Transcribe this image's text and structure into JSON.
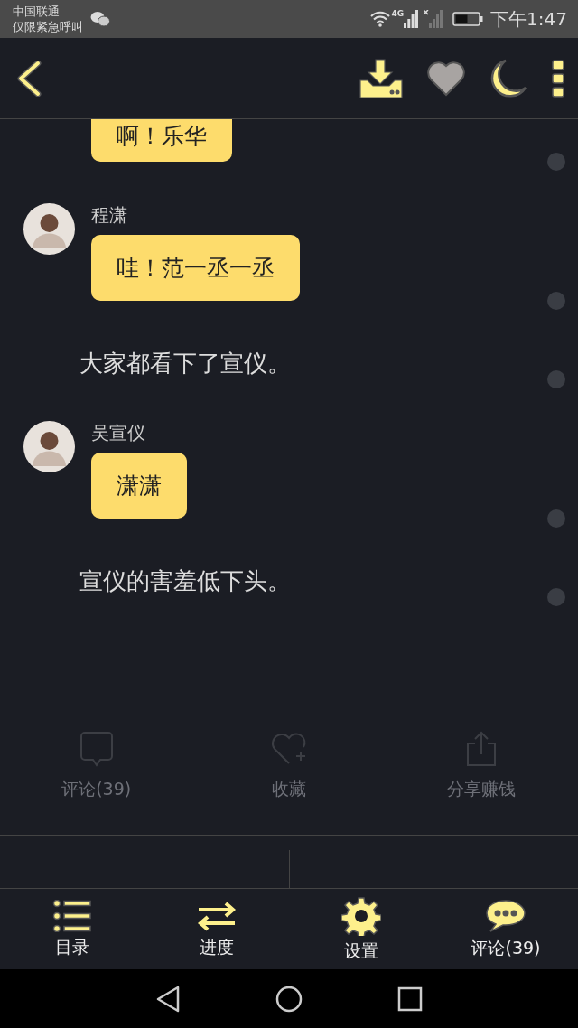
{
  "status_bar": {
    "carrier": "中国联通",
    "notice": "仅限紧急呼叫",
    "network": "4G",
    "time": "下午1:47"
  },
  "header": {
    "favorite": false
  },
  "messages": [
    {
      "kind": "bubble",
      "text": "啊！乐华"
    },
    {
      "kind": "chat",
      "name": "程潇",
      "text": "哇！范一丞一丞"
    },
    {
      "kind": "narration",
      "text": "大家都看下了宣仪。"
    },
    {
      "kind": "chat",
      "name": "吴宣仪",
      "text": "潇潇"
    },
    {
      "kind": "narration",
      "text": "宣仪的害羞低下头。"
    }
  ],
  "actions": [
    {
      "kind": "comment",
      "label": "评论(39)"
    },
    {
      "kind": "favorite",
      "label": "收藏"
    },
    {
      "kind": "share",
      "label": "分享赚钱"
    }
  ],
  "bottom_nav": [
    {
      "kind": "toc",
      "label": "目录"
    },
    {
      "kind": "progress",
      "label": "进度"
    },
    {
      "kind": "settings",
      "label": "设置"
    },
    {
      "kind": "comments",
      "label": "评论(39)"
    }
  ]
}
